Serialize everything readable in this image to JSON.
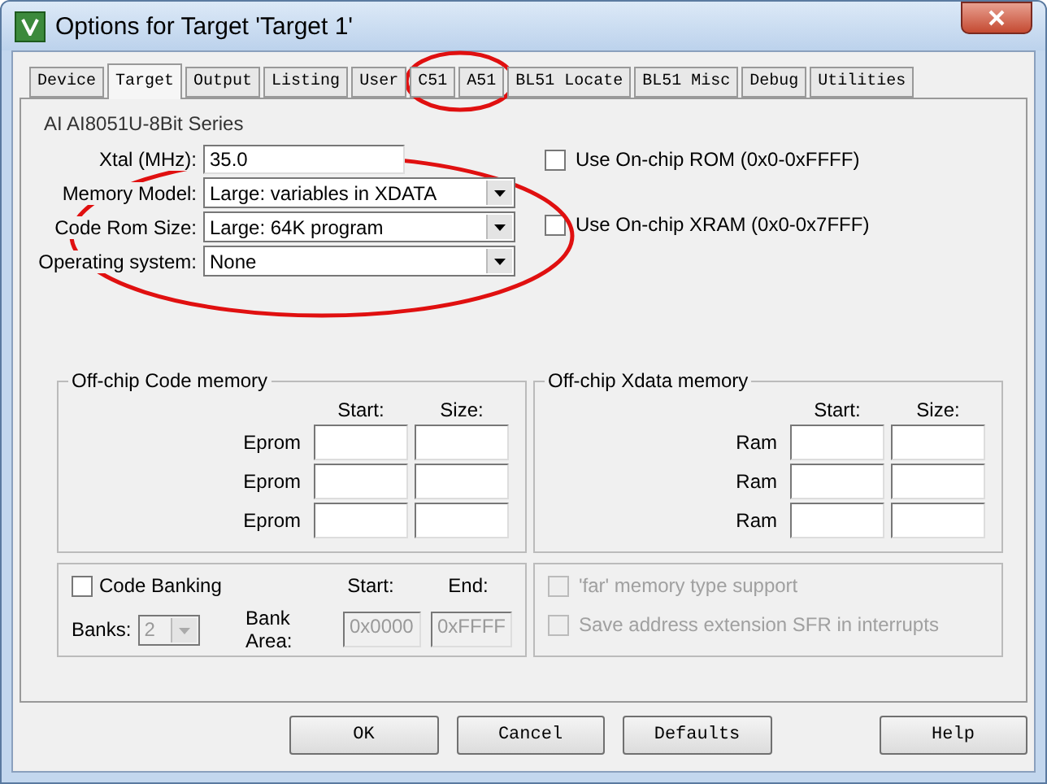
{
  "window": {
    "title": "Options for Target 'Target 1'"
  },
  "tabs": [
    {
      "label": "Device",
      "selected": false
    },
    {
      "label": "Target",
      "selected": true
    },
    {
      "label": "Output",
      "selected": false
    },
    {
      "label": "Listing",
      "selected": false
    },
    {
      "label": "User",
      "selected": false
    },
    {
      "label": "C51",
      "selected": false
    },
    {
      "label": "A51",
      "selected": false
    },
    {
      "label": "BL51 Locate",
      "selected": false
    },
    {
      "label": "BL51 Misc",
      "selected": false
    },
    {
      "label": "Debug",
      "selected": false
    },
    {
      "label": "Utilities",
      "selected": false
    }
  ],
  "device": "AI AI8051U-8Bit Series",
  "xtal": {
    "label": "Xtal (MHz):",
    "value": "35.0"
  },
  "chip_options": [
    {
      "label": "Use On-chip ROM (0x0-0xFFFF)",
      "checked": false
    },
    {
      "label": "Use On-chip XRAM (0x0-0x7FFF)",
      "checked": false
    }
  ],
  "selects": [
    {
      "label": "Memory Model:",
      "value": "Large: variables in XDATA"
    },
    {
      "label": "Code Rom Size:",
      "value": "Large: 64K program"
    },
    {
      "label": "Operating system:",
      "value": "None"
    }
  ],
  "memory_groups": [
    {
      "title": "Off-chip Code memory",
      "columns": [
        "Start:",
        "Size:"
      ],
      "rows": [
        "Eprom",
        "Eprom",
        "Eprom"
      ]
    },
    {
      "title": "Off-chip Xdata memory",
      "columns": [
        "Start:",
        "Size:"
      ],
      "rows": [
        "Ram",
        "Ram",
        "Ram"
      ]
    }
  ],
  "banking": {
    "checkbox": {
      "label": "Code Banking",
      "checked": false
    },
    "banks_label": "Banks:",
    "banks_value": "2",
    "disabled": true,
    "start_label": "Start:",
    "end_label": "End:",
    "area_label": "Bank Area:",
    "start_value": "0x0000",
    "end_value": "0xFFFF"
  },
  "far_options": [
    {
      "label": "'far' memory type support",
      "checked": false,
      "disabled": true
    },
    {
      "label": "Save address extension SFR in interrupts",
      "checked": false,
      "disabled": true
    }
  ],
  "buttons": [
    "OK",
    "Cancel",
    "Defaults",
    "Help"
  ]
}
